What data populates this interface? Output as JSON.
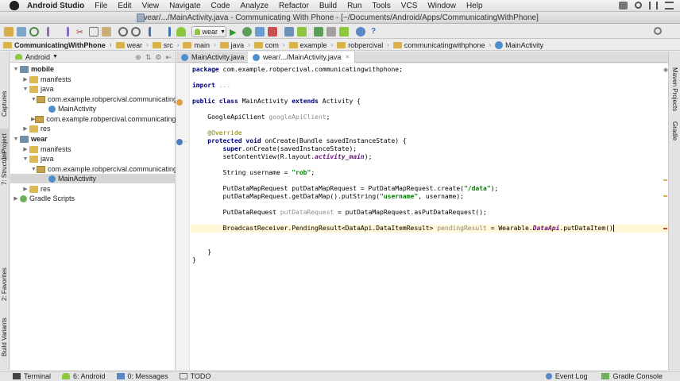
{
  "menubar": {
    "app": "Android Studio",
    "items": [
      "File",
      "Edit",
      "View",
      "Navigate",
      "Code",
      "Analyze",
      "Refactor",
      "Build",
      "Run",
      "Tools",
      "VCS",
      "Window",
      "Help"
    ]
  },
  "window": {
    "title": "wear/.../MainActivity.java - Communicating With Phone - [~/Documents/Android/Apps/CommunicatingWithPhone]"
  },
  "toolbar": {
    "run_config": "wear"
  },
  "breadcrumb": [
    "CommunicatingWithPhone",
    "wear",
    "src",
    "main",
    "java",
    "com",
    "example",
    "robpercival",
    "communicatingwithphone",
    "MainActivity"
  ],
  "left_tool_windows": [
    "1: Project",
    "7: Structure",
    "Captures",
    "2: Favorites",
    "Build Variants"
  ],
  "right_tool_windows": [
    "Maven Projects",
    "Gradle"
  ],
  "project_panel": {
    "view": "Android",
    "tree": [
      {
        "label": "mobile",
        "icon": "module",
        "expanded": true
      },
      {
        "label": "manifests",
        "icon": "folder",
        "expanded": false
      },
      {
        "label": "java",
        "icon": "folder",
        "expanded": true
      },
      {
        "label": "com.example.robpercival.communicatingwithphone",
        "icon": "package",
        "expanded": true
      },
      {
        "label": "MainActivity",
        "icon": "class"
      },
      {
        "label": "com.example.robpercival.communicatingwithphone",
        "icon": "package",
        "expanded": false
      },
      {
        "label": "res",
        "icon": "folder",
        "expanded": false
      },
      {
        "label": "wear",
        "icon": "module",
        "expanded": true
      },
      {
        "label": "manifests",
        "icon": "folder",
        "expanded": false
      },
      {
        "label": "java",
        "icon": "folder",
        "expanded": true
      },
      {
        "label": "com.example.robpercival.communicatingwithphone",
        "icon": "package",
        "expanded": true
      },
      {
        "label": "MainActivity",
        "icon": "class",
        "selected": true
      },
      {
        "label": "res",
        "icon": "folder",
        "expanded": false
      },
      {
        "label": "Gradle Scripts",
        "icon": "gradle",
        "expanded": false
      }
    ]
  },
  "editor_tabs": [
    {
      "label": "MainActivity.java",
      "active": false
    },
    {
      "label": "wear/.../MainActivity.java",
      "active": true
    }
  ],
  "code": {
    "package": "com.example.robpercival.communicatingwithphone;",
    "import": "...",
    "class_name": "MainActivity",
    "superclass": "Activity",
    "field_type": "GoogleApiClient",
    "field_name": "googleApiClient",
    "annotation": "@Override",
    "method": "onCreate",
    "param": "Bundle savedInstanceState",
    "super_call": "super.onCreate(savedInstanceState);",
    "content_view": "setContentView(R.layout.",
    "layout_name": "activity_main",
    "username_decl": "String username = ",
    "username_value": "\"rob\"",
    "path_value": "\"/data\"",
    "key_value": "\"username\"",
    "last_line_a": "BroadcastReceiver.PendingResult<DataApi.DataItemResult> ",
    "last_line_var": "pendingResult",
    "last_line_b": " = Wearable.",
    "last_line_api": "DataApi",
    "last_line_c": ".putDataItem("
  },
  "bottom_bar": [
    "Terminal",
    "6: Android",
    "0: Messages",
    "TODO",
    "Event Log",
    "Gradle Console"
  ]
}
